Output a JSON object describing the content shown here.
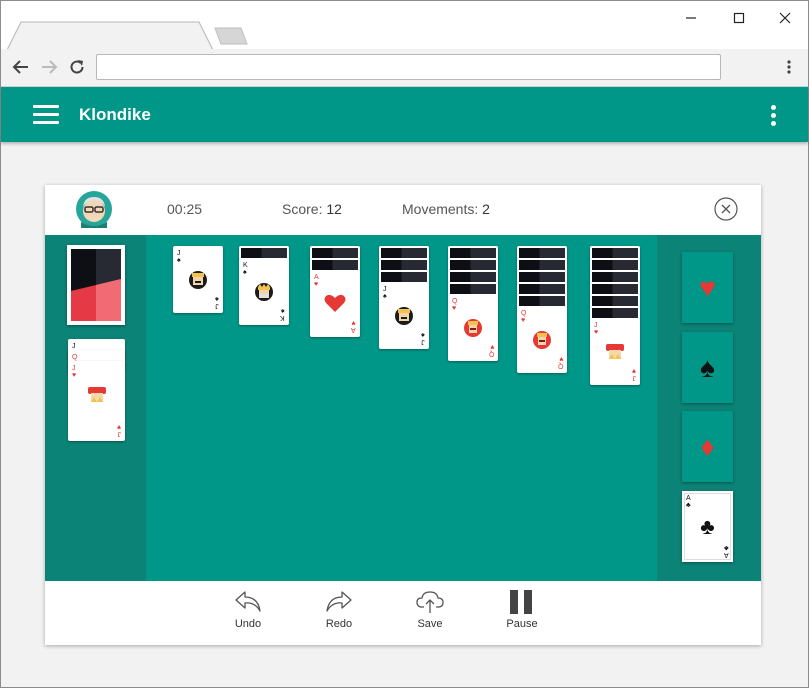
{
  "browser": {
    "address": "",
    "icons": [
      "back-arrow-icon",
      "forward-arrow-icon",
      "reload-icon",
      "more-vert-icon"
    ],
    "window_controls": [
      "minimize-icon",
      "maximize-icon",
      "close-icon"
    ]
  },
  "app": {
    "title": "Klondike",
    "accent": "#009688",
    "panel": "#0c8377"
  },
  "game": {
    "time": "00:25",
    "score_label": "Score:",
    "score": "12",
    "moves_label": "Movements:",
    "moves": "2"
  },
  "waste": [
    {
      "rank": "J",
      "suit": "♠"
    },
    {
      "rank": "Q",
      "suit": "♥"
    },
    {
      "rank": "J",
      "suit": "♥"
    }
  ],
  "tableau": [
    {
      "down": 0,
      "up": [
        {
          "rank": "J",
          "suit": "♠",
          "face": "jack-dark"
        }
      ]
    },
    {
      "down": 1,
      "up": [
        {
          "rank": "K",
          "suit": "♠",
          "face": "king-dark"
        }
      ]
    },
    {
      "down": 2,
      "up": [
        {
          "rank": "A",
          "suit": "♥",
          "face": "ace-heart"
        }
      ]
    },
    {
      "down": 3,
      "up": [
        {
          "rank": "J",
          "suit": "♠",
          "face": "jack-dark"
        }
      ]
    },
    {
      "down": 4,
      "up": [
        {
          "rank": "Q",
          "suit": "♥",
          "face": "queen-red"
        }
      ]
    },
    {
      "down": 5,
      "up": [
        {
          "rank": "Q",
          "suit": "♥",
          "face": "queen-red"
        }
      ]
    },
    {
      "down": 6,
      "up": [
        {
          "rank": "J",
          "suit": "♥",
          "face": "jack-red"
        }
      ]
    }
  ],
  "foundations": [
    {
      "suit": "heart-icon",
      "glyph": "♥",
      "color": "#e53935",
      "card": null
    },
    {
      "suit": "spade-icon",
      "glyph": "♠",
      "color": "#111111",
      "card": null
    },
    {
      "suit": "diamond-icon",
      "glyph": "♦",
      "color": "#e53935",
      "card": null
    },
    {
      "suit": "club-icon",
      "glyph": "♣",
      "color": "#111111",
      "card": {
        "rank": "A",
        "suit": "♣"
      }
    }
  ],
  "footer": {
    "undo": "Undo",
    "redo": "Redo",
    "save": "Save",
    "pause": "Pause"
  }
}
